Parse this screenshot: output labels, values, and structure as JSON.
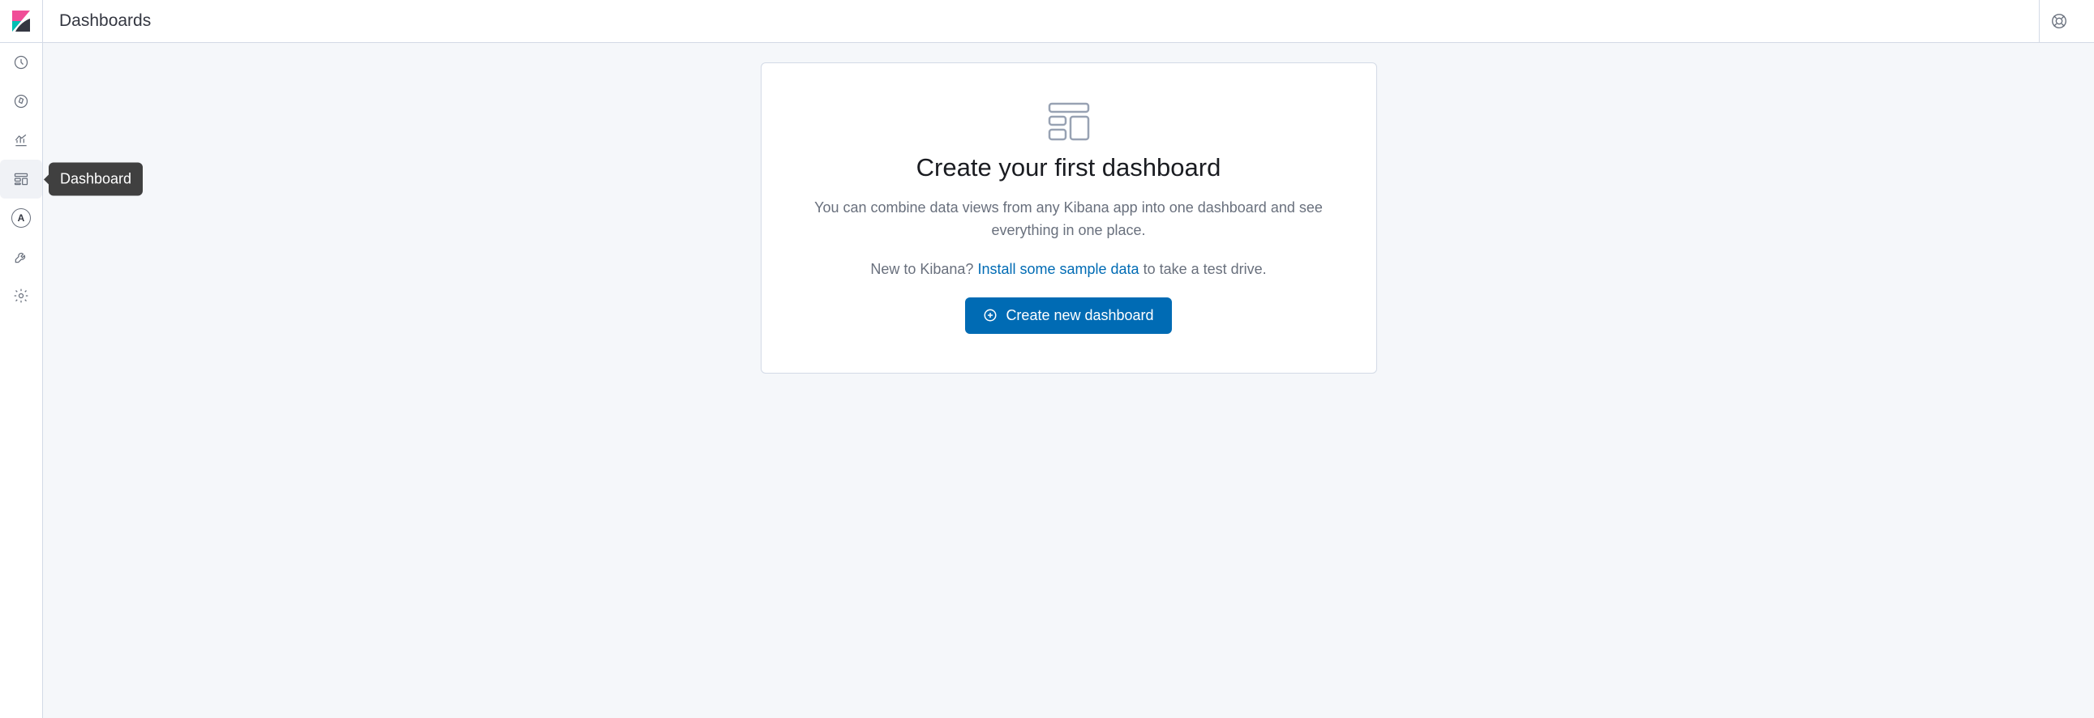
{
  "breadcrumb": "Dashboards",
  "sidenav": {
    "tooltip": "Dashboard",
    "items": [
      {
        "id": "recent",
        "name": "clock-icon"
      },
      {
        "id": "discover",
        "name": "compass-icon"
      },
      {
        "id": "visualize",
        "name": "chart-icon"
      },
      {
        "id": "dashboard",
        "name": "dashboard-icon",
        "active": true,
        "tooltip": true
      },
      {
        "id": "apm",
        "name": "apm-letter-icon",
        "glyph": "A"
      },
      {
        "id": "devtools",
        "name": "wrench-icon"
      },
      {
        "id": "management",
        "name": "gear-icon"
      }
    ]
  },
  "empty_state": {
    "title": "Create your first dashboard",
    "body": "You can combine data views from any Kibana app into one dashboard and see everything in one place.",
    "prompt_pre": "New to Kibana? ",
    "prompt_link": "Install some sample data",
    "prompt_post": " to take a test drive.",
    "button": "Create new dashboard"
  }
}
